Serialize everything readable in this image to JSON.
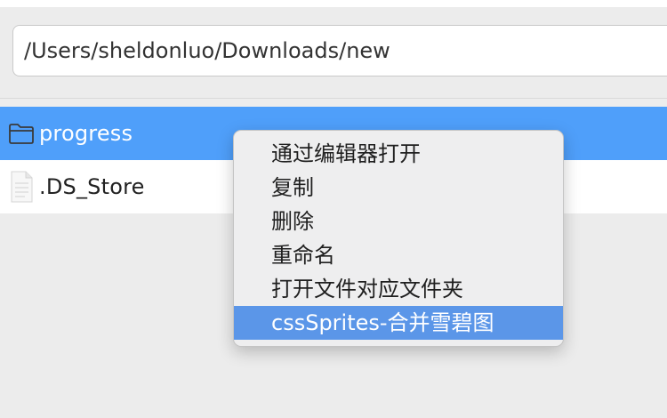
{
  "path_bar": {
    "value": "/Users/sheldonluo/Downloads/new"
  },
  "files": [
    {
      "name": "progress",
      "type": "folder",
      "selected": true,
      "icon": "folder-icon"
    },
    {
      "name": ".DS_Store",
      "type": "file",
      "selected": false,
      "icon": "document-icon"
    }
  ],
  "context_menu": {
    "items": [
      {
        "label": "通过编辑器打开"
      },
      {
        "label": "复制"
      },
      {
        "label": "删除"
      },
      {
        "label": "重命名"
      },
      {
        "label": "打开文件对应文件夹"
      },
      {
        "label": "cssSprites-合并雪碧图",
        "highlighted": true
      }
    ]
  },
  "colors": {
    "selection": "#4f9ffa",
    "menu_highlight": "#5b96e8",
    "menu_background": "#eeeeef"
  }
}
